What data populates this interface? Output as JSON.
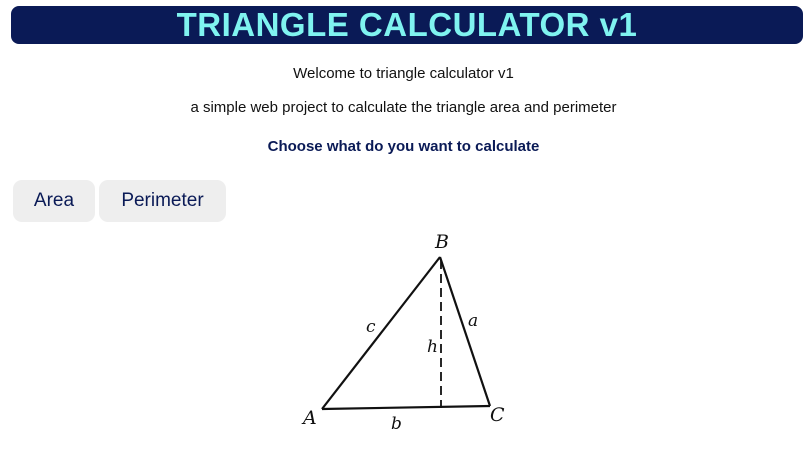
{
  "header": {
    "title": "TRIANGLE CALCULATOR v1",
    "background": "#0a1a56",
    "title_color": "#7ff3f0"
  },
  "intro": {
    "welcome": "Welcome to triangle calculator v1",
    "subtitle": "a simple web project to calculate the triangle area and perimeter",
    "prompt": "Choose what do you want to calculate"
  },
  "buttons": {
    "area_label": "Area",
    "perimeter_label": "Perimeter"
  },
  "figure": {
    "vertex_a": "A",
    "vertex_b": "B",
    "vertex_c": "C",
    "side_a": "a",
    "side_b": "b",
    "side_c": "c",
    "height": "h"
  }
}
